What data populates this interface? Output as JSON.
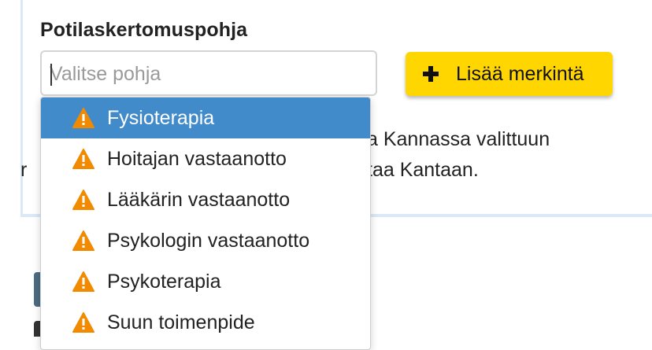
{
  "form": {
    "label": "Potilaskertomuspohja",
    "select": {
      "placeholder": "Valitse pohja",
      "value": ""
    },
    "add_button_label": "Lisää merkintä"
  },
  "background_text": {
    "line1_fragment": "a Kannassa valittuun",
    "line2_fragment": "taa Kantaan.",
    "line2_prefix": "r"
  },
  "dropdown": {
    "items": [
      {
        "label": "Fysioterapia",
        "icon": "warning-icon",
        "selected": true
      },
      {
        "label": "Hoitajan vastaanotto",
        "icon": "warning-icon",
        "selected": false
      },
      {
        "label": "Lääkärin vastaanotto",
        "icon": "warning-icon",
        "selected": false
      },
      {
        "label": "Psykologin vastaanotto",
        "icon": "warning-icon",
        "selected": false
      },
      {
        "label": "Psykoterapia",
        "icon": "warning-icon",
        "selected": false
      },
      {
        "label": "Suun toimenpide",
        "icon": "warning-icon",
        "selected": false
      }
    ]
  },
  "colors": {
    "accent_yellow": "#ffd600",
    "selected_blue": "#428bca",
    "warning_orange": "#f28a00",
    "panel_border": "#dbe9f7"
  }
}
